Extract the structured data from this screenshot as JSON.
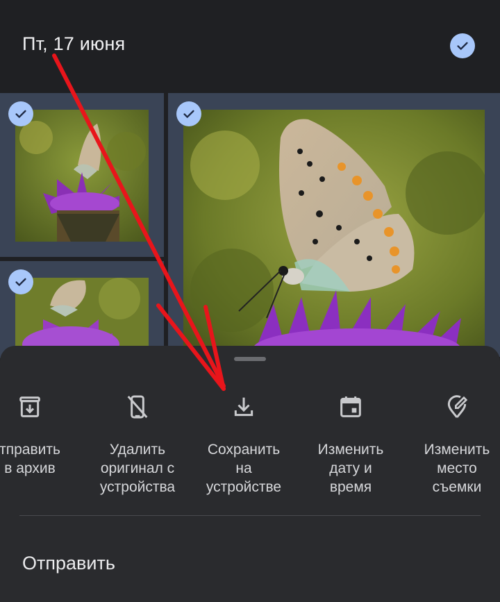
{
  "header": {
    "date_label": "Пт, 17 июня"
  },
  "sheet": {
    "actions": [
      {
        "label": "тправить\nв архив",
        "icon": "archive-icon"
      },
      {
        "label": "Удалить\nоригинал с\nустройства",
        "icon": "phone-off-icon"
      },
      {
        "label": "Сохранить\nна\nустройстве",
        "icon": "download-icon"
      },
      {
        "label": "Изменить\nдату и\nвремя",
        "icon": "calendar-icon"
      },
      {
        "label": "Изменить\nместо\nсъемки",
        "icon": "location-edit-icon"
      }
    ],
    "send_label": "Отправить"
  },
  "colors": {
    "background": "#1f2023",
    "sheet": "#2a2b2e",
    "selection_tile": "#3a4456",
    "check": "#a8c7fa",
    "annotation_arrow": "#e8151b"
  }
}
